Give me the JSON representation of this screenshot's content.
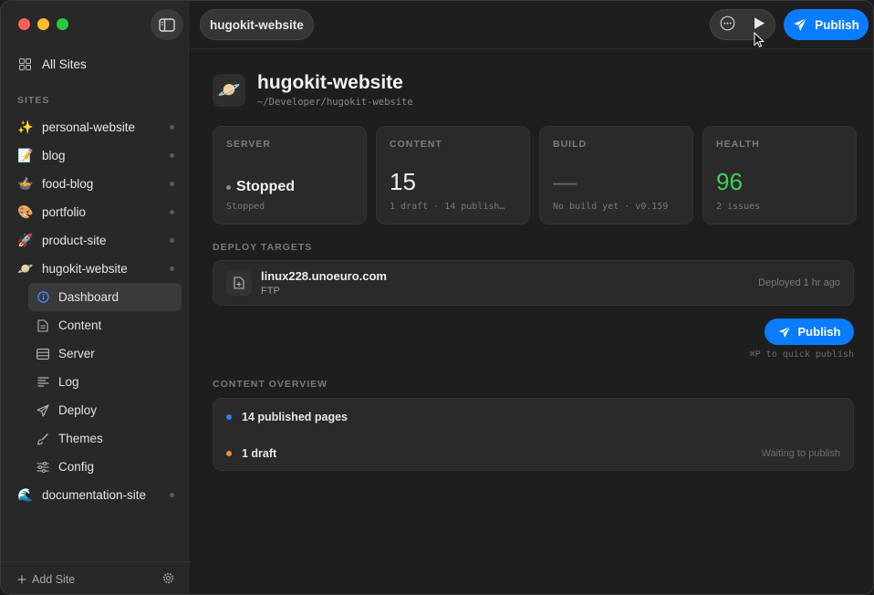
{
  "sidebar": {
    "all_sites": "All Sites",
    "section_label": "SITES",
    "sites": [
      {
        "emoji": "✨",
        "name": "personal-website"
      },
      {
        "emoji": "📝",
        "name": "blog"
      },
      {
        "emoji": "🍲",
        "name": "food-blog"
      },
      {
        "emoji": "🎨",
        "name": "portfolio"
      },
      {
        "emoji": "🚀",
        "name": "product-site"
      },
      {
        "emoji": "🪐",
        "name": "hugokit-website"
      }
    ],
    "sub_items": [
      {
        "label": "Dashboard",
        "icon": "info-icon"
      },
      {
        "label": "Content",
        "icon": "document-icon"
      },
      {
        "label": "Server",
        "icon": "server-icon"
      },
      {
        "label": "Log",
        "icon": "log-icon"
      },
      {
        "label": "Deploy",
        "icon": "paper-plane-icon"
      },
      {
        "label": "Themes",
        "icon": "brush-icon"
      },
      {
        "label": "Config",
        "icon": "sliders-icon"
      }
    ],
    "last_site": {
      "emoji": "🌊",
      "name": "documentation-site"
    },
    "add_site": "Add Site"
  },
  "topbar": {
    "crumb": "hugokit-website",
    "publish_label": "Publish"
  },
  "header": {
    "title": "hugokit-website",
    "path": "~/Developer/hugokit-website",
    "icon_emoji": "🪐"
  },
  "cards": {
    "server": {
      "label": "SERVER",
      "value": "Stopped",
      "sub": "Stopped"
    },
    "content": {
      "label": "CONTENT",
      "value": "15",
      "sub": "1 draft · 14 publish…"
    },
    "build": {
      "label": "BUILD",
      "value": "—",
      "sub": "No build yet · v0.159"
    },
    "health": {
      "label": "HEALTH",
      "value": "96",
      "sub": "2 issues"
    }
  },
  "deploy_targets": {
    "label": "DEPLOY TARGETS",
    "host": "linux228.unoeuro.com",
    "protocol": "FTP",
    "status": "Deployed 1 hr ago"
  },
  "publish_button": "Publish",
  "publish_hint": "⌘P to quick publish",
  "overview": {
    "label": "CONTENT OVERVIEW",
    "published": "14 published pages",
    "draft": "1 draft",
    "draft_note": "Waiting to publish"
  },
  "colors": {
    "accent": "#0a7cff",
    "health": "#3fcf5a",
    "published_dot": "#2f7cf6",
    "draft_dot": "#f08a3c"
  }
}
